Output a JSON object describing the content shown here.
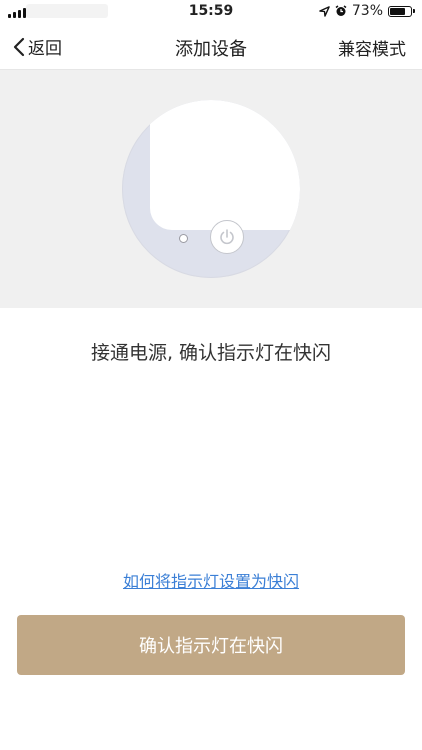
{
  "status_bar": {
    "time": "15:59",
    "battery": "73%",
    "battery_level": 0.73,
    "icons": [
      "signal-icon",
      "location-icon",
      "alarm-icon",
      "battery-icon"
    ]
  },
  "nav": {
    "back_label": "返回",
    "title": "添加设备",
    "right_action": "兼容模式"
  },
  "main": {
    "instruction": "接通电源, 确认指示灯在快闪",
    "help_link": "如何将指示灯设置为快闪",
    "confirm_button": "确认指示灯在快闪"
  },
  "colors": {
    "accent": "#c1a886",
    "link": "#3b7fd6",
    "hero_bg": "#f0f0f0",
    "device_frame": "#dee1ec"
  }
}
